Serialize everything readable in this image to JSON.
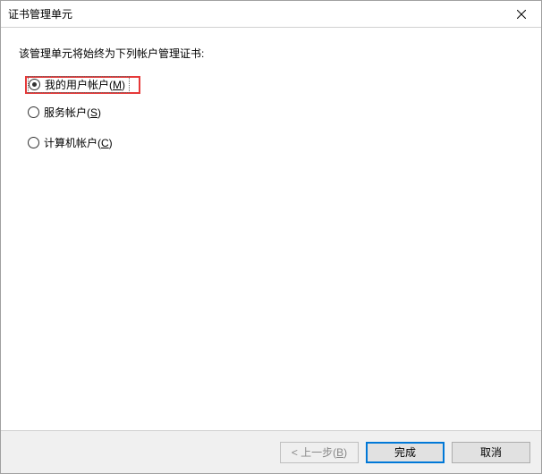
{
  "window": {
    "title": "证书管理单元"
  },
  "content": {
    "instruction": "该管理单元将始终为下列帐户管理证书:",
    "options": {
      "my_user_pre": "我的用户帐户(",
      "my_user_key": "M",
      "my_user_post": ")",
      "service_pre": "服务帐户(",
      "service_key": "S",
      "service_post": ")",
      "computer_pre": "计算机帐户(",
      "computer_key": "C",
      "computer_post": ")"
    }
  },
  "buttons": {
    "back_pre": "< 上一步(",
    "back_key": "B",
    "back_post": ")",
    "finish": "完成",
    "cancel": "取消"
  }
}
